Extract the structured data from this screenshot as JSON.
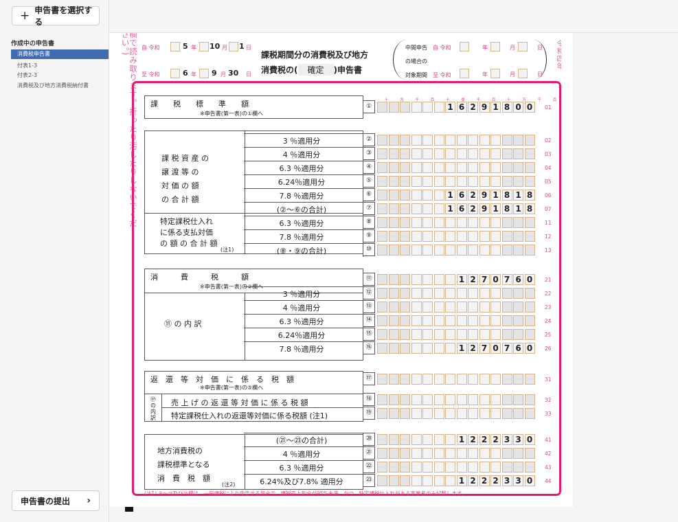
{
  "sidebar": {
    "select_button": "申告書を選択する",
    "heading": "作成中の申告書",
    "items": [
      "消費税申告書",
      "付表1-3",
      "付表2-3",
      "消費税及び地方消費税納付書"
    ],
    "submit_button": "申告書の提出"
  },
  "doc": {
    "side_note": "欄で読み取ります。折ったり汚したりしないでください。)",
    "right_side": "令和四年",
    "from_label": "自 令和",
    "to_label": "至 令和",
    "from": {
      "year": "5",
      "month": "10",
      "day": "1"
    },
    "to": {
      "year": "6",
      "month": "9",
      "day": "30"
    },
    "unit_year": "年",
    "unit_month": "月",
    "unit_day": "日",
    "title_line1": "課税期間分の消費税及び地方",
    "title_line2_a": "消費税の(",
    "title_type": "確定",
    "title_line2_b": ")申告書",
    "interim_1": "中間申告",
    "interim_2": "の場合の",
    "interim_3": "対象期間",
    "interim_from": "自 令和",
    "interim_to": "至 令和",
    "digit_units": "十 兆 千 百 十 億 千 百 十 万 千 百 十 一円"
  },
  "form": {
    "base_label": "課　　税　　標　　準　　額",
    "base_sub": "※申告書(第一表)の①欄へ",
    "asset_label": [
      "課 税 資 産 の",
      "譲 渡 等 の",
      "対 価 の 額",
      "の 合 計 額"
    ],
    "specific_label": [
      "特定課税仕入れ",
      "に係る支払対価",
      "の 額 の 合 計 額"
    ],
    "note1": "(注1)",
    "tax_label": "消　　　費　　　税　　　額",
    "tax_sub": "※申告書(第一表)の②欄へ",
    "breakdown_label": "⑪ の 内 訳",
    "refund_label": "返　還　等　対　価　に　係　る　税　額",
    "refund_sub": "※申告書(第一表)の⑤欄へ",
    "refund_breakdown_label": "⑰の内訳",
    "refund_row1": "売 上 げ の 返 還 等 対 価 に 係 る 税 額",
    "refund_row2": "特定課税仕入れの返還等対価に係る税額 (注1)",
    "local_label": [
      "地方消費税の",
      "課税標準となる",
      "消　費　税　額"
    ],
    "note2": "(注2)",
    "footnote": "(注1) ⑧～⑩及び⑲欄は、一般課税により申告する場合で、課税売上割合が95%未満、かつ、特定課税仕入れがある事業者のみ記載します。",
    "rows": [
      {
        "no": "①",
        "code": "01",
        "label": "",
        "value": "16291800"
      },
      {
        "no": "②",
        "code": "02",
        "label": "3 ％適用分",
        "value": ""
      },
      {
        "no": "③",
        "code": "03",
        "label": "4 ％適用分",
        "value": ""
      },
      {
        "no": "④",
        "code": "04",
        "label": "6.3 ％適用分",
        "value": ""
      },
      {
        "no": "⑤",
        "code": "05",
        "label": "6.24％適用分",
        "value": ""
      },
      {
        "no": "⑥",
        "code": "06",
        "label": "7.8 ％適用分",
        "value": "16291818"
      },
      {
        "no": "⑦",
        "code": "07",
        "label": "(②～⑥の合計)",
        "value": "16291818"
      },
      {
        "no": "⑧",
        "code": "11",
        "label": "6.3 ％適用分",
        "value": ""
      },
      {
        "no": "⑨",
        "code": "12",
        "label": "7.8 ％適用分",
        "value": ""
      },
      {
        "no": "⑩",
        "code": "13",
        "label": "(⑧・⑨の合計)",
        "value": ""
      },
      {
        "no": "⑪",
        "code": "21",
        "label": "",
        "value": "1270760"
      },
      {
        "no": "⑫",
        "code": "22",
        "label": "3 ％適用分",
        "value": ""
      },
      {
        "no": "⑬",
        "code": "23",
        "label": "4 ％適用分",
        "value": ""
      },
      {
        "no": "⑭",
        "code": "24",
        "label": "6.3 ％適用分",
        "value": ""
      },
      {
        "no": "⑮",
        "code": "25",
        "label": "6.24％適用分",
        "value": ""
      },
      {
        "no": "⑯",
        "code": "26",
        "label": "7.8 ％適用分",
        "value": "1270760"
      },
      {
        "no": "⑰",
        "code": "31",
        "label": "",
        "value": ""
      },
      {
        "no": "⑱",
        "code": "32",
        "label": "",
        "value": ""
      },
      {
        "no": "⑲",
        "code": "33",
        "label": "",
        "value": ""
      },
      {
        "no": "⑳",
        "code": "41",
        "label": "(㉑～㉓の合計)",
        "value": "1222330"
      },
      {
        "no": "㉑",
        "code": "42",
        "label": "4 ％適用分",
        "value": ""
      },
      {
        "no": "㉒",
        "code": "43",
        "label": "6.3 ％適用分",
        "value": ""
      },
      {
        "no": "㉓",
        "code": "44",
        "label": "6.24%及び7.8% 適用分",
        "value": "1222330"
      }
    ]
  }
}
